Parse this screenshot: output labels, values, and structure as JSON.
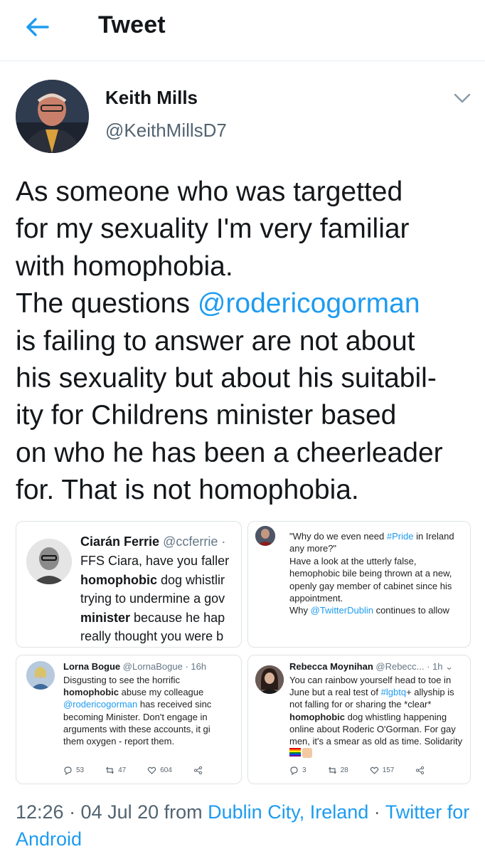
{
  "header": {
    "title": "Tweet"
  },
  "author": {
    "name": "Keith Mills",
    "handle": "@KeithMillsD7"
  },
  "tweet": {
    "lines": [
      [
        {
          "t": "As someone who was targetted"
        }
      ],
      [
        {
          "t": "for my sexuality I'm very familiar"
        }
      ],
      [
        {
          "t": "with homophobia."
        }
      ],
      [
        {
          "t": "The questions "
        },
        {
          "t": "@rodericogorman",
          "link": true
        }
      ],
      [
        {
          "t": "is failing to answer are not about"
        }
      ],
      [
        {
          "t": "his sexuality but about his suitabil-"
        }
      ],
      [
        {
          "t": "ity for Childrens minister based"
        }
      ],
      [
        {
          "t": "on who he has been a cheerleader"
        }
      ],
      [
        {
          "t": "for. That is not homophobia."
        }
      ]
    ]
  },
  "media": {
    "panel1": {
      "name": "Ciarán Ferrie",
      "handle": "@ccferrie ·",
      "lines": [
        [
          {
            "t": "FFS Ciara, have you faller"
          }
        ],
        [
          {
            "t": "homophobic",
            "b": true
          },
          {
            "t": " dog whistlir"
          }
        ],
        [
          {
            "t": "trying to undermine a gov"
          }
        ],
        [
          {
            "t": "minister",
            "b": true
          },
          {
            "t": " because he hap"
          }
        ],
        [
          {
            "t": "really thought you were b"
          }
        ]
      ]
    },
    "panel2": {
      "lines": [
        [
          {
            "t": "\"Why do we even need "
          },
          {
            "t": "#Pride",
            "link": true
          },
          {
            "t": " in Ireland"
          }
        ],
        [
          {
            "t": "any more?\""
          }
        ],
        [
          {
            "t": " "
          }
        ],
        [
          {
            "t": "Have a look at the utterly false,"
          }
        ],
        [
          {
            "t": "hemophobic bile being thrown at a new,"
          }
        ],
        [
          {
            "t": "openly gay member of cabinet since his"
          }
        ],
        [
          {
            "t": "appointment."
          }
        ],
        [
          {
            "t": " "
          }
        ],
        [
          {
            "t": "Why "
          },
          {
            "t": "@TwitterDublin",
            "link": true
          },
          {
            "t": " continues to allow"
          }
        ]
      ]
    },
    "panel3": {
      "name": "Lorna Bogue",
      "handle": "@LornaBogue · 16h",
      "lines": [
        [
          {
            "t": "Disgusting to see the horrific"
          }
        ],
        [
          {
            "t": "homophobic",
            "b": true
          },
          {
            "t": " abuse my colleague"
          }
        ],
        [
          {
            "t": "@rodericogorman",
            "link": true
          },
          {
            "t": " has received sinc"
          }
        ],
        [
          {
            "t": "becoming Minister. Don't engage in"
          }
        ],
        [
          {
            "t": "arguments with these accounts, it gi"
          }
        ],
        [
          {
            "t": "them oxygen - report them."
          }
        ]
      ],
      "replies": "53",
      "retweets": "47",
      "likes": "604"
    },
    "panel4": {
      "name": "Rebecca Moynihan",
      "handle": "@Rebecc... · 1h",
      "lines": [
        [
          {
            "t": "You can rainbow yourself head to toe in"
          }
        ],
        [
          {
            "t": "June but a real test of "
          },
          {
            "t": "#lgbtq",
            "link": true
          },
          {
            "t": "+ allyship is"
          }
        ],
        [
          {
            "t": "not falling for or sharing the *clear*"
          }
        ],
        [
          {
            "t": "homophobic",
            "b": true
          },
          {
            "t": " dog whistling happening"
          }
        ],
        [
          {
            "t": "online about Roderic O'Gorman. For gay"
          }
        ],
        [
          {
            "t": "men, it's a smear as old as time. Solidarity"
          }
        ]
      ],
      "replies": "3",
      "retweets": "28",
      "likes": "157"
    }
  },
  "footer": {
    "time": "12:26 · 04 Jul 20 from ",
    "location": "Dublin City, Ireland",
    "sep": " · ",
    "source": "Twitter for Android"
  },
  "colors": {
    "link": "#1d9bf0",
    "text": "#14171a",
    "muted": "#536471"
  },
  "icons": [
    "back-arrow-icon",
    "chevron-down-icon",
    "reply-icon",
    "retweet-icon",
    "like-icon",
    "share-icon"
  ]
}
